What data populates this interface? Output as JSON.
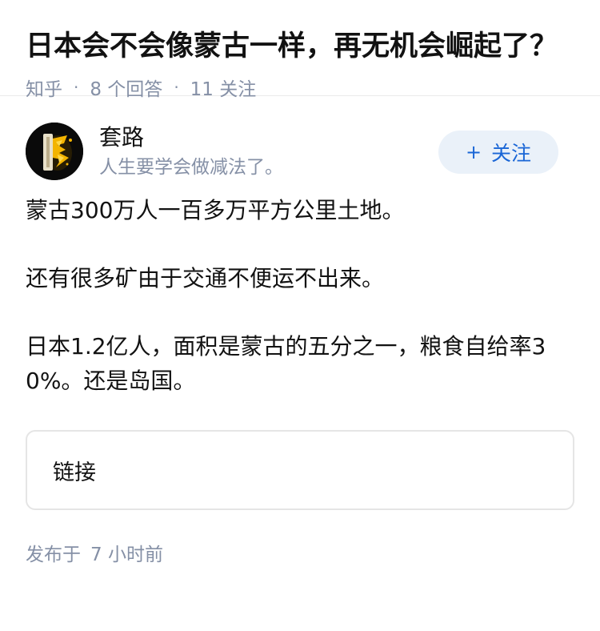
{
  "question": {
    "title": "日本会不会像蒙古一样，再无机会崛起了？",
    "source": "知乎",
    "answer_count": "8 个回答",
    "follower_count": "11 关注",
    "separator": "·"
  },
  "author": {
    "name": "套路",
    "bio": "人生要学会做减法了。",
    "follow_icon": "+",
    "follow_label": "关注"
  },
  "answer": {
    "paragraphs": [
      "蒙古300万人一百多万平方公里土地。",
      "还有很多矿由于交通不便运不出来。",
      "日本1.2亿人，面积是蒙古的五分之一，粮食自给率30%。还是岛国。"
    ],
    "link_label": "链接"
  },
  "footer": {
    "published_prefix": "发布于",
    "published_time": "7 小时前"
  },
  "colors": {
    "accent": "#1a66d6",
    "meta_gray": "#8590a6",
    "follow_bg": "#eaf1f9"
  }
}
